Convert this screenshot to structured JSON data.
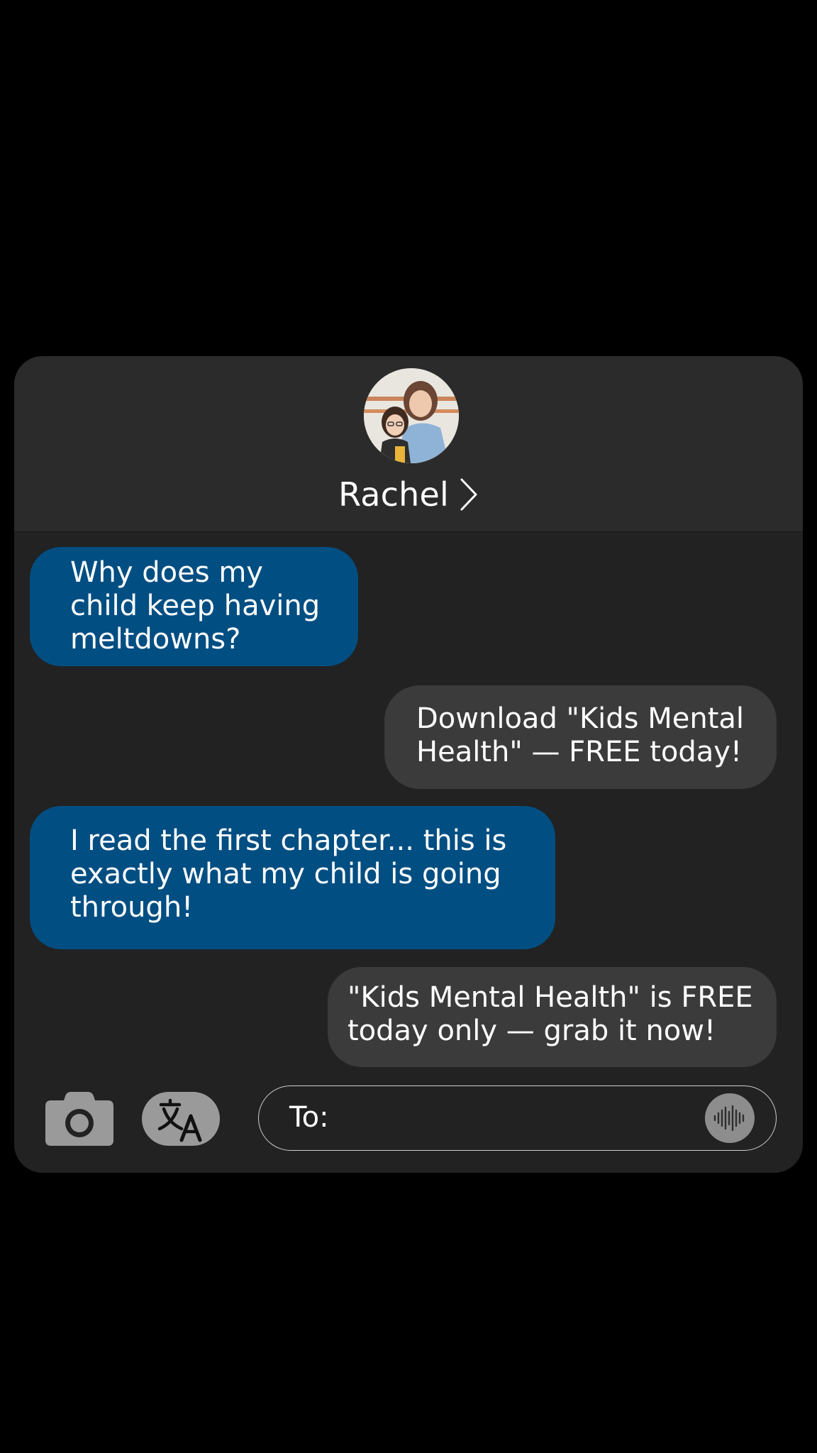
{
  "contact": {
    "name": "Rachel",
    "avatar": "profile-photo",
    "chevron_icon": "chevron-right-icon"
  },
  "messages": [
    {
      "direction": "incoming",
      "text": "Why does my\nchild keep having\nmeltdowns?"
    },
    {
      "direction": "outgoing",
      "text": "Download \"Kids Mental\nHealth\" — FREE today!"
    },
    {
      "direction": "incoming",
      "text": "I read the first chapter... this is\nexactly what my child is going\nthrough!"
    },
    {
      "direction": "outgoing",
      "text": "\"Kids Mental Health\" is FREE\ntoday only — grab it now!"
    }
  ],
  "composer": {
    "camera_icon": "camera-icon",
    "translate_icon": "translate-icon",
    "to_label": "To:",
    "audio_icon": "audio-waveform-icon"
  },
  "colors": {
    "incoming_bubble": "#014e82",
    "outgoing_bubble": "#3b3b3b",
    "panel_background": "#222222",
    "header_background": "#2b2b2b",
    "page_background": "#000000"
  }
}
